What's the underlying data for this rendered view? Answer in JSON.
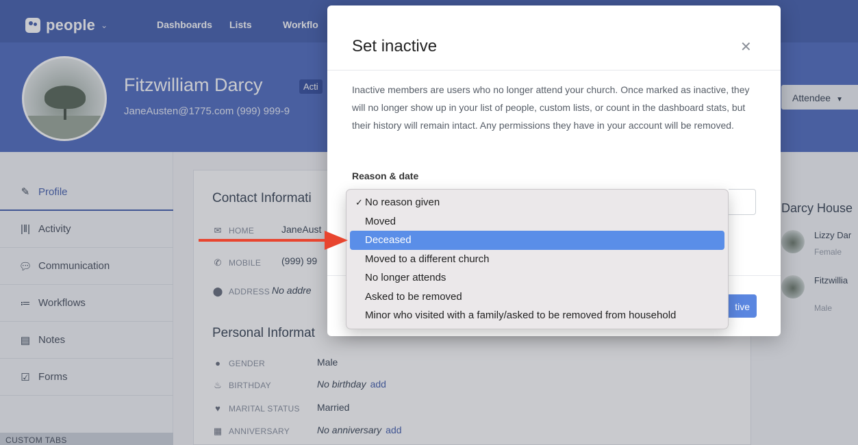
{
  "nav": {
    "brand": "people",
    "links": [
      "Dashboards",
      "Lists",
      "Workflo"
    ]
  },
  "profile": {
    "name": "Fitzwilliam Darcy",
    "status_badge": "Acti",
    "contact": "JaneAusten@1775.com   (999) 999-9",
    "role_dropdown": "Attendee"
  },
  "sidebar": {
    "items": [
      {
        "label": "Profile",
        "icon": "pencil-icon"
      },
      {
        "label": "Activity",
        "icon": "activity-bars-icon"
      },
      {
        "label": "Communication",
        "icon": "chat-bubble-icon"
      },
      {
        "label": "Workflows",
        "icon": "workflows-icon"
      },
      {
        "label": "Notes",
        "icon": "note-icon"
      },
      {
        "label": "Forms",
        "icon": "form-icon"
      }
    ],
    "custom_tabs": "CUSTOM TABS"
  },
  "contact_info": {
    "title": "Contact Informati",
    "rows": [
      {
        "label": "HOME",
        "value": "JaneAust",
        "icon": "envelope-icon"
      },
      {
        "label": "MOBILE",
        "value": "(999) 99",
        "icon": "phone-icon"
      },
      {
        "label": "ADDRESS",
        "value": "No addre",
        "icon": "location-pin-icon"
      }
    ]
  },
  "personal_info": {
    "title": "Personal Informat",
    "rows": [
      {
        "label": "GENDER",
        "value": "Male",
        "icon": "person-icon",
        "add": ""
      },
      {
        "label": "BIRTHDAY",
        "value": "No birthday",
        "icon": "cake-icon",
        "add": "add"
      },
      {
        "label": "MARITAL STATUS",
        "value": "Married",
        "icon": "heart-icon",
        "add": ""
      },
      {
        "label": "ANNIVERSARY",
        "value": "No anniversary",
        "icon": "calendar-icon",
        "add": "add"
      }
    ]
  },
  "household": {
    "title": "Darcy House",
    "members": [
      {
        "name": "Lizzy Dar",
        "gender": "Female"
      },
      {
        "name": "Fitzwillia",
        "gender": "Male"
      }
    ]
  },
  "modal": {
    "title": "Set inactive",
    "description": "Inactive members are users who no longer attend your church. Once marked as inactive, they will no longer show up in your list of people, custom lists, or count in the dashboard stats, but their history will remain intact. Any permissions they have in your account will be removed.",
    "reason_label": "Reason & date",
    "submit_partial": "tive"
  },
  "dropdown": {
    "checked_index": 0,
    "highlighted_index": 2,
    "options": [
      "No reason given",
      "Moved",
      "Deceased",
      "Moved to a different church",
      "No longer attends",
      "Asked to be removed",
      "Minor who visited with a family/asked to be removed from household"
    ]
  },
  "colors": {
    "nav_bg": "#4a64b0",
    "header_bg": "#5470c2",
    "highlight": "#5a8ee8",
    "annotation_arrow": "#e8452f"
  }
}
